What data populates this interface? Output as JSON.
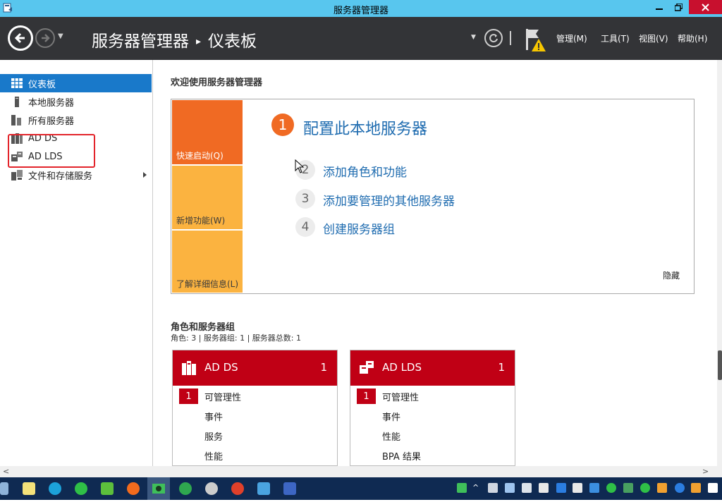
{
  "window": {
    "title": "服务器管理器"
  },
  "header": {
    "breadcrumb_root": "服务器管理器",
    "breadcrumb_sep": "▸",
    "breadcrumb_current": "仪表板",
    "menus": [
      {
        "label": "管理(M)"
      },
      {
        "label": "工具(T)"
      },
      {
        "label": "视图(V)"
      },
      {
        "label": "帮助(H)"
      }
    ]
  },
  "sidebar": {
    "items": [
      {
        "label": "仪表板",
        "icon": "dashboard-icon",
        "selected": true
      },
      {
        "label": "本地服务器",
        "icon": "local-server-icon"
      },
      {
        "label": "所有服务器",
        "icon": "all-servers-icon"
      },
      {
        "label": "AD DS",
        "icon": "ad-ds-icon"
      },
      {
        "label": "AD LDS",
        "icon": "ad-lds-icon"
      },
      {
        "label": "文件和存储服务",
        "icon": "file-storage-icon",
        "expandable": true
      }
    ]
  },
  "welcome": {
    "title": "欢迎使用服务器管理器",
    "tiles": [
      {
        "label": "快速启动(Q)"
      },
      {
        "label": "新增功能(W)"
      },
      {
        "label": "了解详细信息(L)"
      }
    ],
    "main_step": {
      "num": "1",
      "label": "配置此本地服务器"
    },
    "steps": [
      {
        "num": "2",
        "label": "添加角色和功能"
      },
      {
        "num": "3",
        "label": "添加要管理的其他服务器"
      },
      {
        "num": "4",
        "label": "创建服务器组"
      }
    ],
    "hide_label": "隐藏"
  },
  "roles": {
    "title": "角色和服务器组",
    "summary": "角色: 3 | 服务器组: 1 | 服务器总数: 1",
    "cards": [
      {
        "name": "AD DS",
        "count": "1",
        "badge": "1",
        "rows": [
          "可管理性",
          "事件",
          "服务",
          "性能"
        ]
      },
      {
        "name": "AD LDS",
        "count": "1",
        "badge": "1",
        "rows": [
          "可管理性",
          "事件",
          "性能",
          "BPA 结果"
        ]
      }
    ]
  },
  "colors": {
    "titlebar": "#58c6ee",
    "header": "#333437",
    "accent": "#1979ca",
    "quick_start": "#f06a23",
    "tile": "#fbb340",
    "role_red": "#c00015",
    "taskbar": "#0f2a52"
  }
}
